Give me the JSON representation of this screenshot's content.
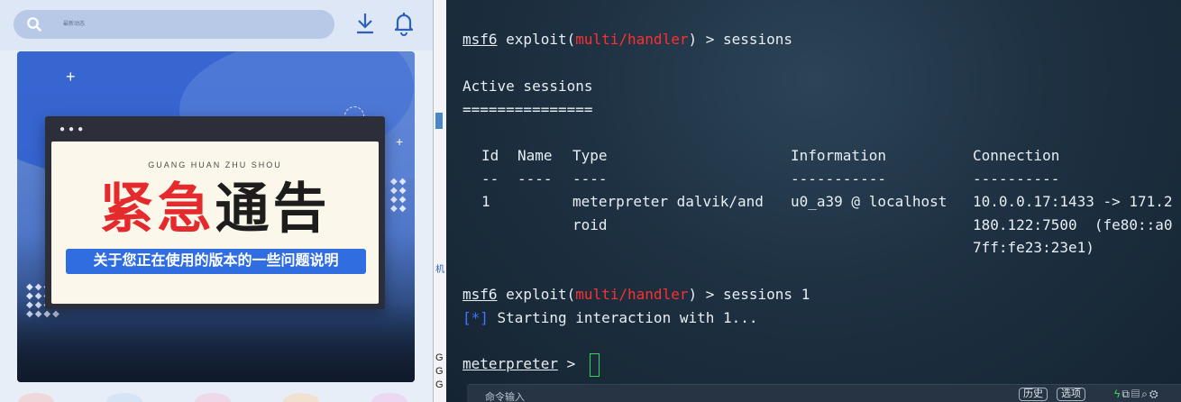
{
  "phone": {
    "search_placeholder": "最新动态",
    "notice": {
      "subtitle": "GUANG HUAN ZHU SHOU",
      "headline_red": "紧急",
      "headline_dark": "通告",
      "pill_text": "关于您正在使用的版本的一些问题说明"
    }
  },
  "divider": {
    "text_ji": "机",
    "text_g1": "G",
    "text_g2": "G",
    "text_g3": "G"
  },
  "terminal": {
    "prompt_msf": "msf6",
    "prompt_exploit": " exploit(",
    "module": "multi/handler",
    "prompt_close": ") > ",
    "cmd1": "sessions",
    "cmd2": "sessions 1",
    "active_sessions": "Active sessions",
    "rule": "===============",
    "headers": {
      "id": "Id",
      "name": "Name",
      "type": "Type",
      "information": "Information",
      "connection": "Connection"
    },
    "header_rules": {
      "id": "--",
      "name": "----",
      "type": "----",
      "information": "-----------",
      "connection": "----------"
    },
    "session_row": {
      "id": "1",
      "type_line1": "meterpreter dalvik/and",
      "type_line2": "roid",
      "information": "u0_a39 @ localhost",
      "connection_line1": "10.0.0.17:1433 -> 171.2",
      "connection_line2": "180.122:7500  (fe80::a0",
      "connection_line3": "7ff:fe23:23e1)"
    },
    "status_tag": "[*]",
    "status_text": " Starting interaction with 1...",
    "meterpreter_prompt": "meterpreter",
    "meterpreter_arrow": " > "
  },
  "cmdbar": {
    "placeholder": "命令输入",
    "history_button": "历史",
    "options_button": "选项"
  },
  "colors": {
    "module_red": "#ff2f2f",
    "status_blue": "#3e76ff",
    "cursor_green": "#37d35a",
    "pill_blue": "#2f6de1",
    "headline_red": "#e52a2e"
  }
}
